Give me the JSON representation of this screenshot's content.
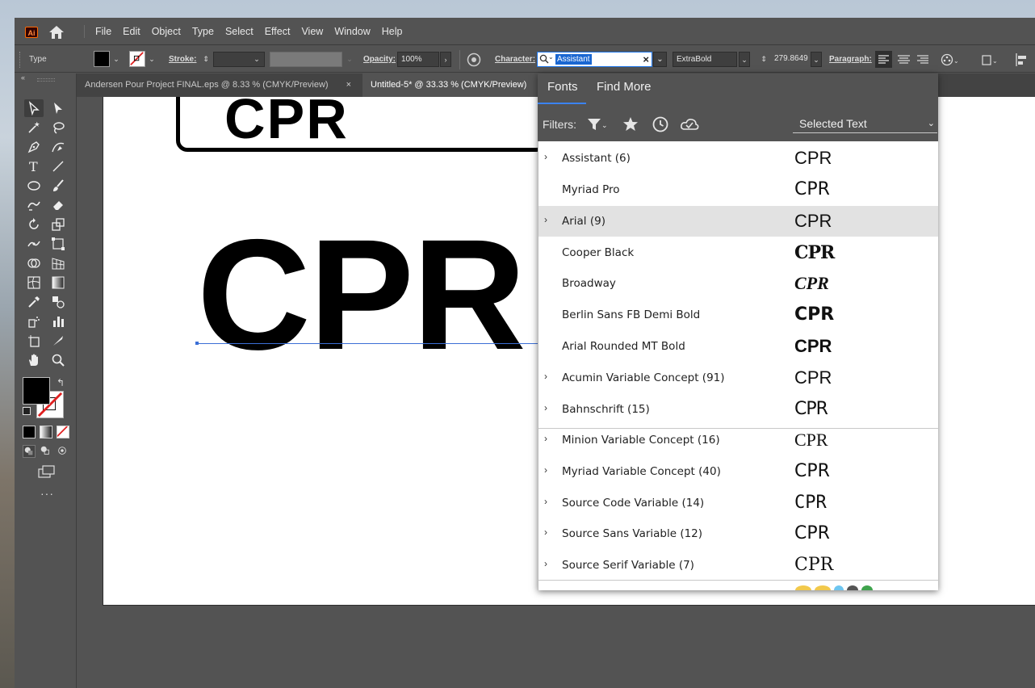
{
  "app": {
    "logo": "Ai",
    "menus": [
      "File",
      "Edit",
      "Object",
      "Type",
      "Select",
      "Effect",
      "View",
      "Window",
      "Help"
    ]
  },
  "control_bar": {
    "mode_label": "Type",
    "stroke_label": "Stroke:",
    "opacity_label": "Opacity:",
    "opacity_value": "100%",
    "character_label": "Character:",
    "font_search_value": "Assistant",
    "font_style": "ExtraBold",
    "font_size": "279.8649",
    "paragraph_label": "Paragraph:"
  },
  "tabs": [
    {
      "label": "Andersen Pour Project FINAL.eps @ 8.33 % (CMYK/Preview)",
      "close": "×"
    },
    {
      "label": "Untitled-5* @ 33.33 % (CMYK/Preview)",
      "close": "×"
    }
  ],
  "canvas": {
    "sign_text": "CPR",
    "big_text": "CPR"
  },
  "font_panel": {
    "tab_fonts": "Fonts",
    "tab_find_more": "Find More",
    "filters_label": "Filters:",
    "show_dropdown": "Selected Text",
    "fonts": [
      {
        "name": "Assistant (6)",
        "expandable": true,
        "sample": "CPR"
      },
      {
        "name": "Myriad Pro",
        "expandable": false,
        "sample": "CPR"
      },
      {
        "name": "Arial (9)",
        "expandable": true,
        "sample": "CPR",
        "highlighted": true
      },
      {
        "name": "Cooper Black",
        "expandable": false,
        "sample": "CPR"
      },
      {
        "name": "Broadway",
        "expandable": false,
        "sample": "CPR"
      },
      {
        "name": "Berlin Sans FB Demi Bold",
        "expandable": false,
        "sample": "CPR"
      },
      {
        "name": "Arial Rounded MT Bold",
        "expandable": false,
        "sample": "CPR"
      },
      {
        "name": "Acumin Variable Concept (91)",
        "expandable": true,
        "sample": "CPR"
      },
      {
        "name": "Bahnschrift (15)",
        "expandable": true,
        "sample": "CPR"
      },
      {
        "name": "Minion Variable Concept (16)",
        "expandable": true,
        "sample": "CPR"
      },
      {
        "name": "Myriad Variable Concept (40)",
        "expandable": true,
        "sample": "CPR"
      },
      {
        "name": "Source Code Variable (14)",
        "expandable": true,
        "sample": "CPR"
      },
      {
        "name": "Source Sans Variable (12)",
        "expandable": true,
        "sample": "CPR"
      },
      {
        "name": "Source Serif Variable (7)",
        "expandable": true,
        "sample": "CPR"
      }
    ]
  },
  "colors": {
    "ui_bg": "#535353",
    "accent": "#1a67d2",
    "row_highlight": "#e2e2e2"
  },
  "icons": {
    "tools": [
      "selection-tool",
      "direct-selection-tool",
      "magic-wand-tool",
      "lasso-tool",
      "pen-tool",
      "curvature-tool",
      "type-tool",
      "line-tool",
      "ellipse-tool",
      "paintbrush-tool",
      "shaper-tool",
      "eraser-tool",
      "rotate-tool",
      "scale-tool",
      "puppet-warp-tool",
      "free-transform-tool",
      "shape-builder-tool",
      "perspective-grid-tool",
      "mesh-tool",
      "gradient-tool",
      "eyedropper-tool",
      "blend-tool",
      "symbol-sprayer-tool",
      "column-graph-tool",
      "artboard-tool",
      "slice-tool",
      "hand-tool",
      "zoom-tool"
    ]
  }
}
